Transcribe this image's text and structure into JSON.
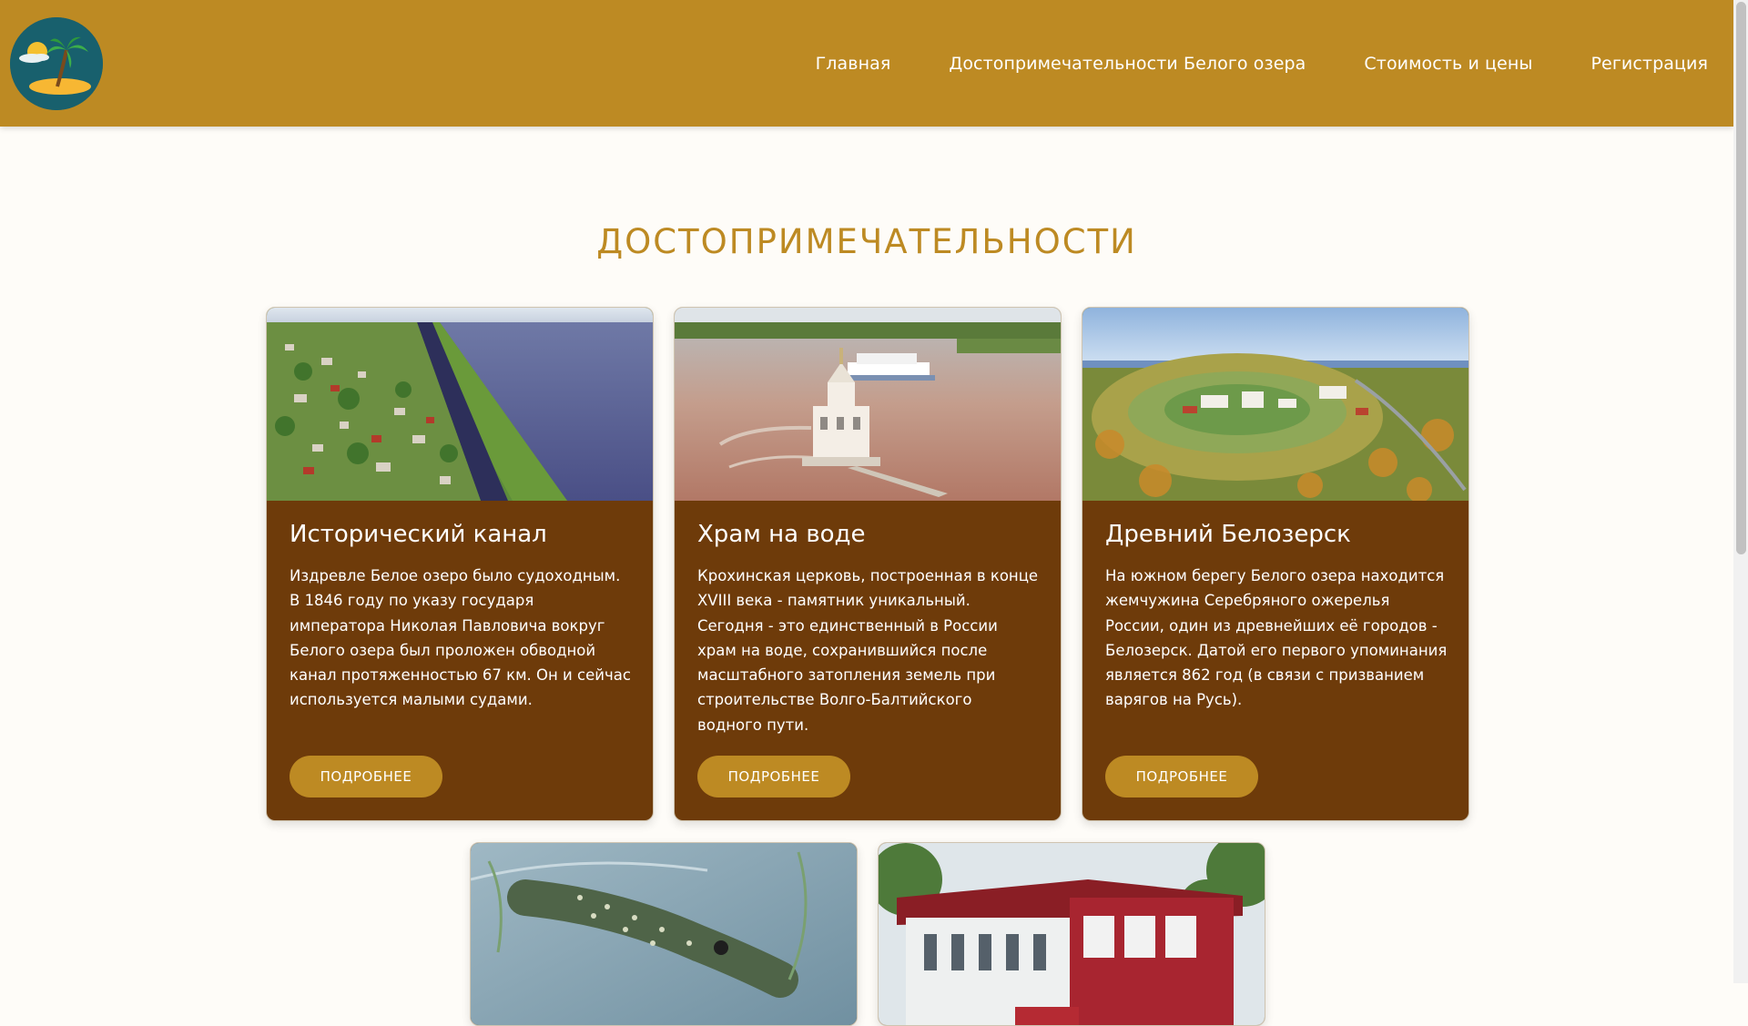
{
  "header": {
    "logo_icon": "palm-island-logo-icon",
    "nav": [
      {
        "label": "Главная"
      },
      {
        "label": "Достопримечательности Белого озера"
      },
      {
        "label": "Стоимость и цены"
      },
      {
        "label": "Регистрация"
      }
    ]
  },
  "main": {
    "title": "ДОСТОПРИМЕЧАТЕЛЬНОСТИ",
    "cards": [
      {
        "title": "Исторический канал",
        "text": "Издревле Белое озеро было судоходным. В 1846 году по указу государя императора Николая Павловича вокруг Белого озера был проложен обводной канал протяженностью 67 км. Он и сейчас используется малыми судами.",
        "button": "ПОДРОБНЕЕ"
      },
      {
        "title": "Храм на воде",
        "text": "Крохинская церковь, построенная в конце XVIII века - памятник уникальный. Сегодня - это единственный в России храм на воде, сохранившийся после масштабного затопления земель при строительстве Волго-Балтийского водного пути.",
        "button": "ПОДРОБНЕЕ"
      },
      {
        "title": "Древний Белозерск",
        "text": "На южном берегу Белого озера находится жемчужина Серебряного ожерелья России, один из древнейших её городов - Белозерск. Датой его первого упоминания является 862 год (в связи с призванием варягов на Русь).",
        "button": "ПОДРОБНЕЕ"
      }
    ]
  },
  "colors": {
    "header": "#bd8a23",
    "accent": "#bd8a23",
    "card_bg": "#6e3b0a",
    "page_bg": "#fefcf8"
  }
}
